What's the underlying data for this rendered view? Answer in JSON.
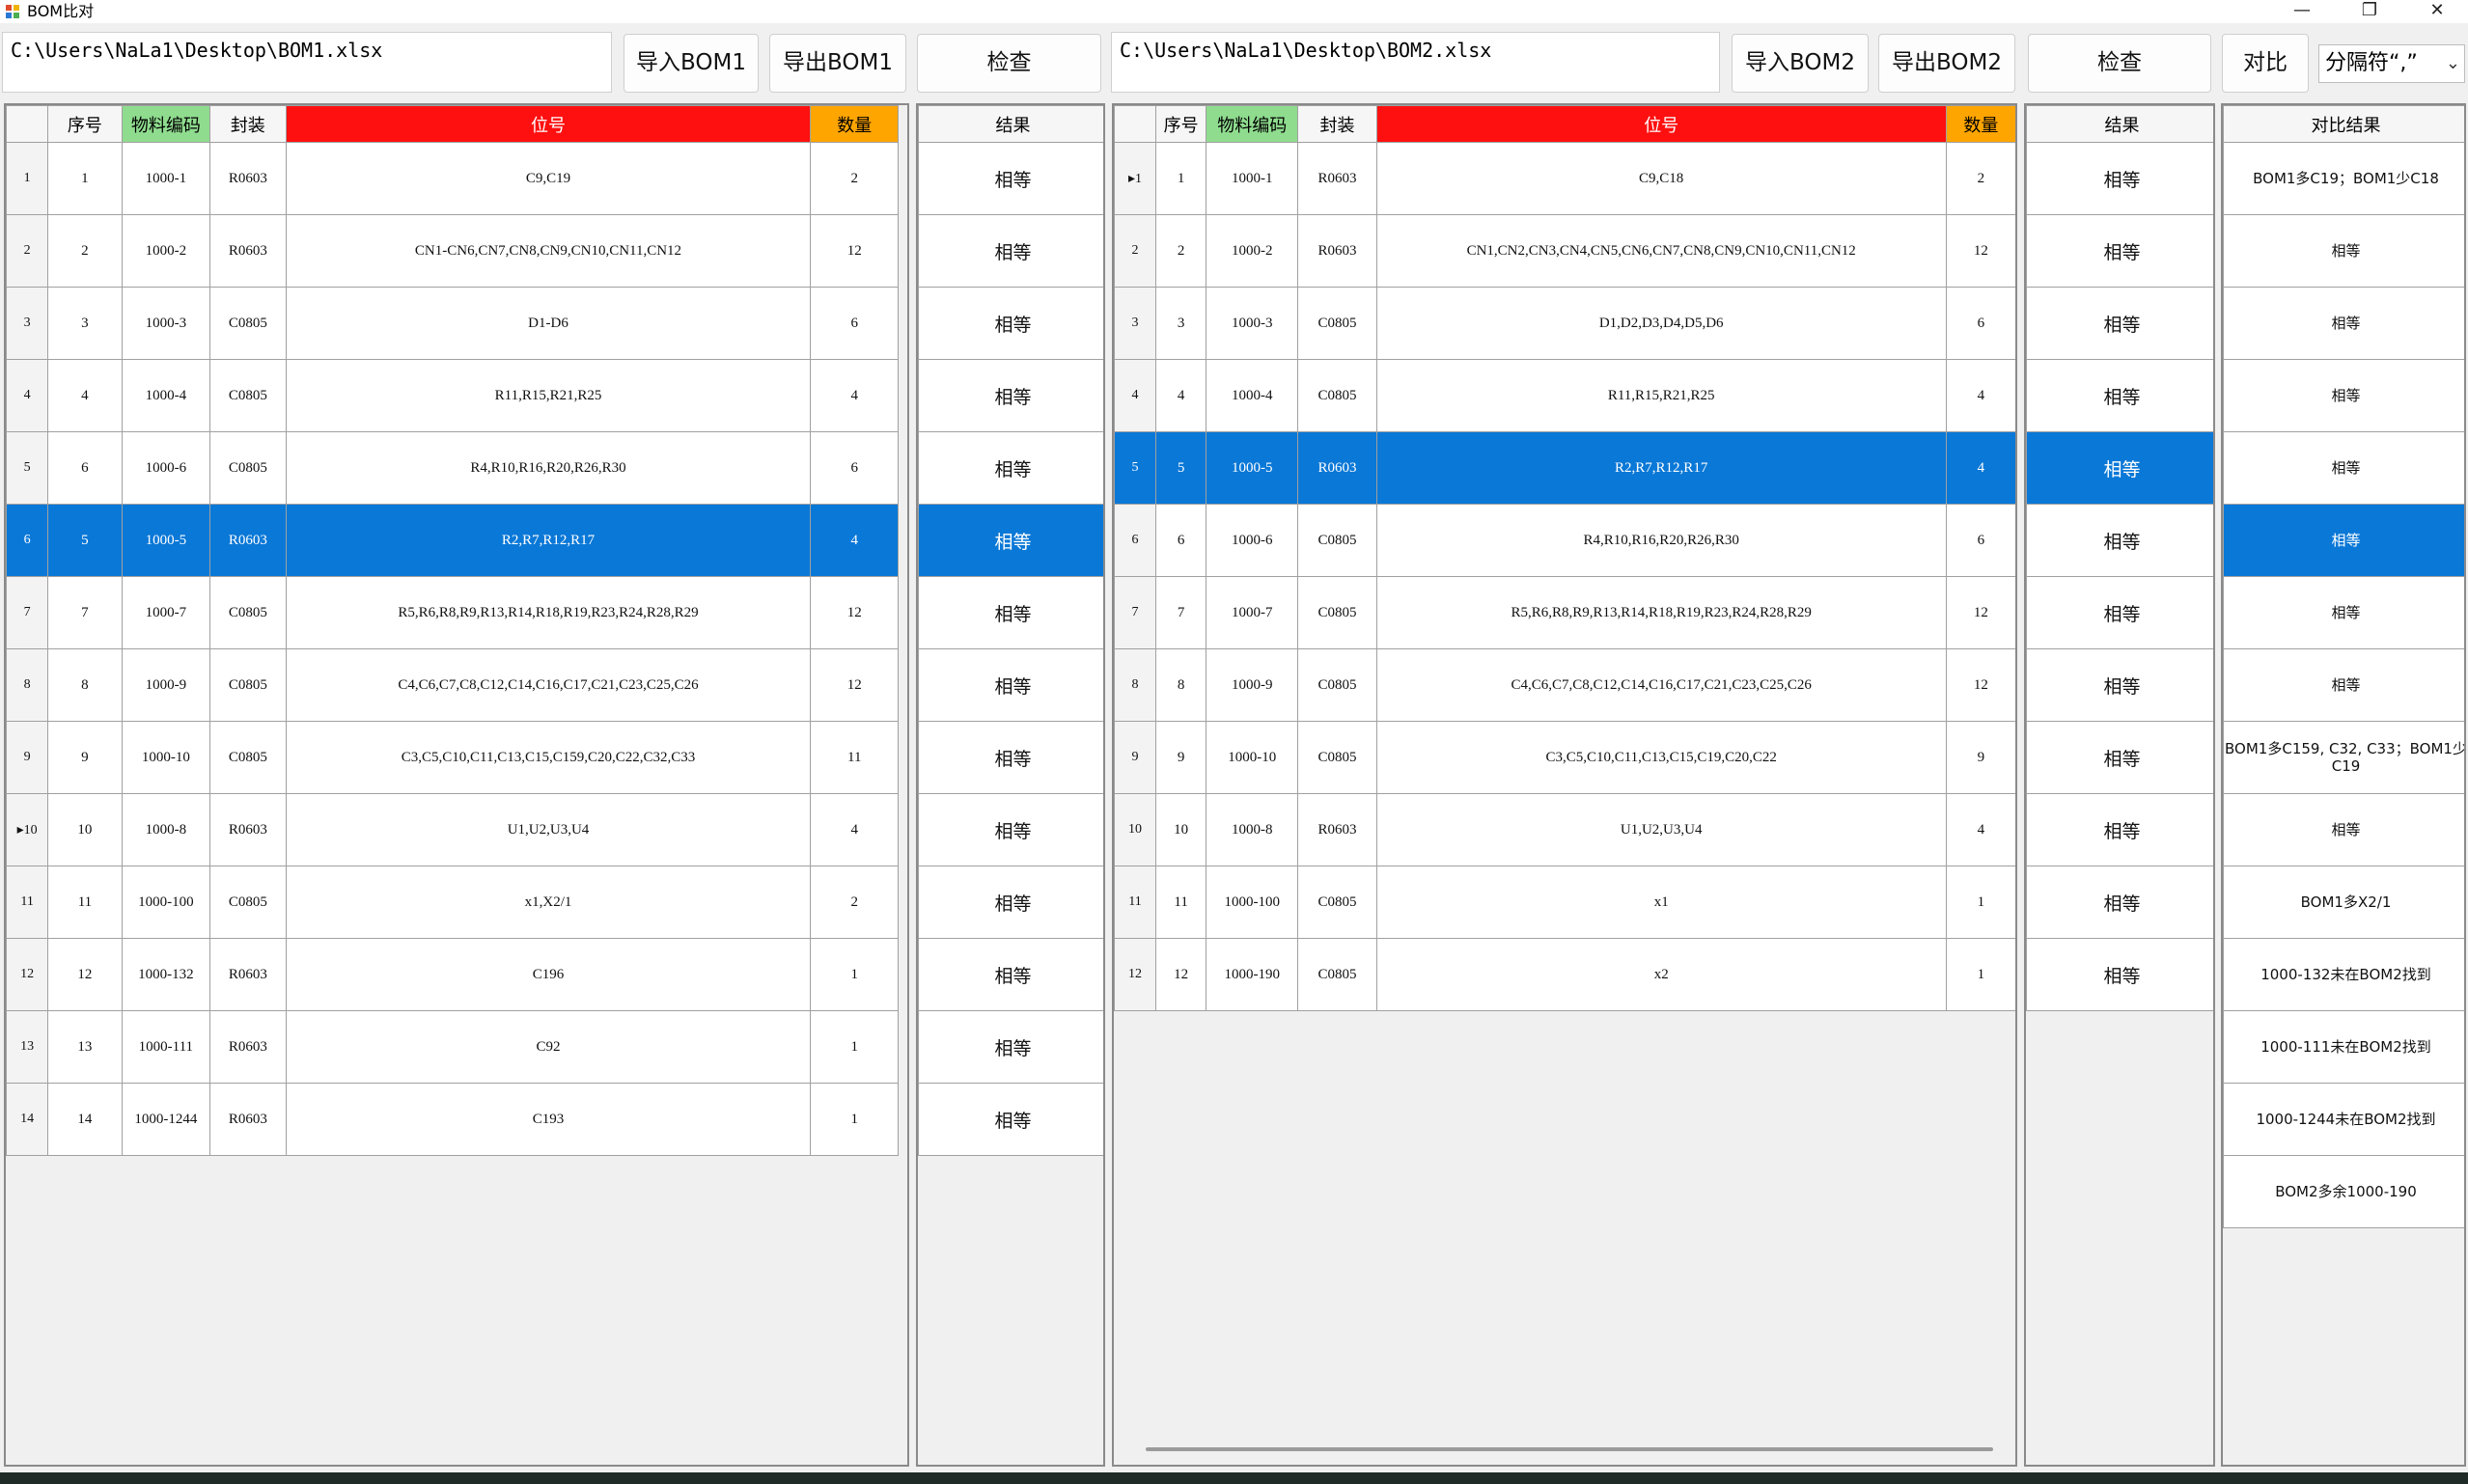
{
  "window": {
    "title": "BOM比对",
    "controls": {
      "minimize": "—",
      "maximize": "❐",
      "close": "✕"
    }
  },
  "toolbar1": {
    "path": "C:\\Users\\NaLa1\\Desktop\\BOM1.xlsx",
    "import_label": "导入BOM1",
    "export_label": "导出BOM1",
    "check_label": "检查"
  },
  "toolbar2": {
    "path": "C:\\Users\\NaLa1\\Desktop\\BOM2.xlsx",
    "import_label": "导入BOM2",
    "export_label": "导出BOM2",
    "check_label": "检查",
    "compare_label": "对比",
    "separator_value": "分隔符“,”"
  },
  "headers": {
    "seq": "序号",
    "code": "物料编码",
    "package": "封装",
    "ref": "位号",
    "qty": "数量",
    "result": "结果",
    "compare_result": "对比结果"
  },
  "colors": {
    "code_header": "#8fdc8f",
    "ref_header": "#ff1010",
    "qty_header": "#ffa500",
    "selection": "#0a78d7"
  },
  "bom1": {
    "rows": [
      {
        "rh": "1",
        "seq": "1",
        "code": "1000-1",
        "package": "R0603",
        "ref": "C9,C19",
        "qty": "2"
      },
      {
        "rh": "2",
        "seq": "2",
        "code": "1000-2",
        "package": "R0603",
        "ref": "CN1-CN6,CN7,CN8,CN9,CN10,CN11,CN12",
        "qty": "12"
      },
      {
        "rh": "3",
        "seq": "3",
        "code": "1000-3",
        "package": "C0805",
        "ref": "D1-D6",
        "qty": "6"
      },
      {
        "rh": "4",
        "seq": "4",
        "code": "1000-4",
        "package": "C0805",
        "ref": "R11,R15,R21,R25",
        "qty": "4"
      },
      {
        "rh": "5",
        "seq": "6",
        "code": "1000-6",
        "package": "C0805",
        "ref": "R4,R10,R16,R20,R26,R30",
        "qty": "6"
      },
      {
        "rh": "6",
        "seq": "5",
        "code": "1000-5",
        "package": "R0603",
        "ref": "R2,R7,R12,R17",
        "qty": "4",
        "selected": true
      },
      {
        "rh": "7",
        "seq": "7",
        "code": "1000-7",
        "package": "C0805",
        "ref": "R5,R6,R8,R9,R13,R14,R18,R19,R23,R24,R28,R29",
        "qty": "12"
      },
      {
        "rh": "8",
        "seq": "8",
        "code": "1000-9",
        "package": "C0805",
        "ref": "C4,C6,C7,C8,C12,C14,C16,C17,C21,C23,C25,C26",
        "qty": "12"
      },
      {
        "rh": "9",
        "seq": "9",
        "code": "1000-10",
        "package": "C0805",
        "ref": "C3,C5,C10,C11,C13,C15,C159,C20,C22,C32,C33",
        "qty": "11"
      },
      {
        "rh": "▸10",
        "seq": "10",
        "code": "1000-8",
        "package": "R0603",
        "ref": "U1,U2,U3,U4",
        "qty": "4"
      },
      {
        "rh": "11",
        "seq": "11",
        "code": "1000-100",
        "package": "C0805",
        "ref": "x1,X2/1",
        "qty": "2"
      },
      {
        "rh": "12",
        "seq": "12",
        "code": "1000-132",
        "package": "R0603",
        "ref": "C196",
        "qty": "1"
      },
      {
        "rh": "13",
        "seq": "13",
        "code": "1000-111",
        "package": "R0603",
        "ref": "C92",
        "qty": "1"
      },
      {
        "rh": "14",
        "seq": "14",
        "code": "1000-1244",
        "package": "R0603",
        "ref": "C193",
        "qty": "1"
      }
    ],
    "results": [
      "相等",
      "相等",
      "相等",
      "相等",
      "相等",
      "相等",
      "相等",
      "相等",
      "相等",
      "相等",
      "相等",
      "相等",
      "相等",
      "相等"
    ],
    "selected_index": 5
  },
  "bom2": {
    "rows": [
      {
        "rh": "▸1",
        "seq": "1",
        "code": "1000-1",
        "package": "R0603",
        "ref": "C9,C18",
        "qty": "2"
      },
      {
        "rh": "2",
        "seq": "2",
        "code": "1000-2",
        "package": "R0603",
        "ref": "CN1,CN2,CN3,CN4,CN5,CN6,CN7,CN8,CN9,CN10,CN11,CN12",
        "qty": "12"
      },
      {
        "rh": "3",
        "seq": "3",
        "code": "1000-3",
        "package": "C0805",
        "ref": "D1,D2,D3,D4,D5,D6",
        "qty": "6"
      },
      {
        "rh": "4",
        "seq": "4",
        "code": "1000-4",
        "package": "C0805",
        "ref": "R11,R15,R21,R25",
        "qty": "4"
      },
      {
        "rh": "5",
        "seq": "5",
        "code": "1000-5",
        "package": "R0603",
        "ref": "R2,R7,R12,R17",
        "qty": "4",
        "selected": true
      },
      {
        "rh": "6",
        "seq": "6",
        "code": "1000-6",
        "package": "C0805",
        "ref": "R4,R10,R16,R20,R26,R30",
        "qty": "6"
      },
      {
        "rh": "7",
        "seq": "7",
        "code": "1000-7",
        "package": "C0805",
        "ref": "R5,R6,R8,R9,R13,R14,R18,R19,R23,R24,R28,R29",
        "qty": "12"
      },
      {
        "rh": "8",
        "seq": "8",
        "code": "1000-9",
        "package": "C0805",
        "ref": "C4,C6,C7,C8,C12,C14,C16,C17,C21,C23,C25,C26",
        "qty": "12"
      },
      {
        "rh": "9",
        "seq": "9",
        "code": "1000-10",
        "package": "C0805",
        "ref": "C3,C5,C10,C11,C13,C15,C19,C20,C22",
        "qty": "9"
      },
      {
        "rh": "10",
        "seq": "10",
        "code": "1000-8",
        "package": "R0603",
        "ref": "U1,U2,U3,U4",
        "qty": "4"
      },
      {
        "rh": "11",
        "seq": "11",
        "code": "1000-100",
        "package": "C0805",
        "ref": "x1",
        "qty": "1"
      },
      {
        "rh": "12",
        "seq": "12",
        "code": "1000-190",
        "package": "C0805",
        "ref": "x2",
        "qty": "1"
      }
    ],
    "results": [
      "相等",
      "相等",
      "相等",
      "相等",
      "相等",
      "相等",
      "相等",
      "相等",
      "相等",
      "相等",
      "相等",
      "相等"
    ],
    "selected_index": 4
  },
  "compare": {
    "results": [
      "BOM1多C19；BOM1少C18",
      "相等",
      "相等",
      "相等",
      "相等",
      "相等",
      "相等",
      "相等",
      "BOM1多C159, C32, C33；BOM1少C19",
      "相等",
      "BOM1多X2/1",
      "1000-132未在BOM2找到",
      "1000-111未在BOM2找到",
      "1000-1244未在BOM2找到",
      "BOM2多余1000-190"
    ],
    "selected_index": 5
  }
}
